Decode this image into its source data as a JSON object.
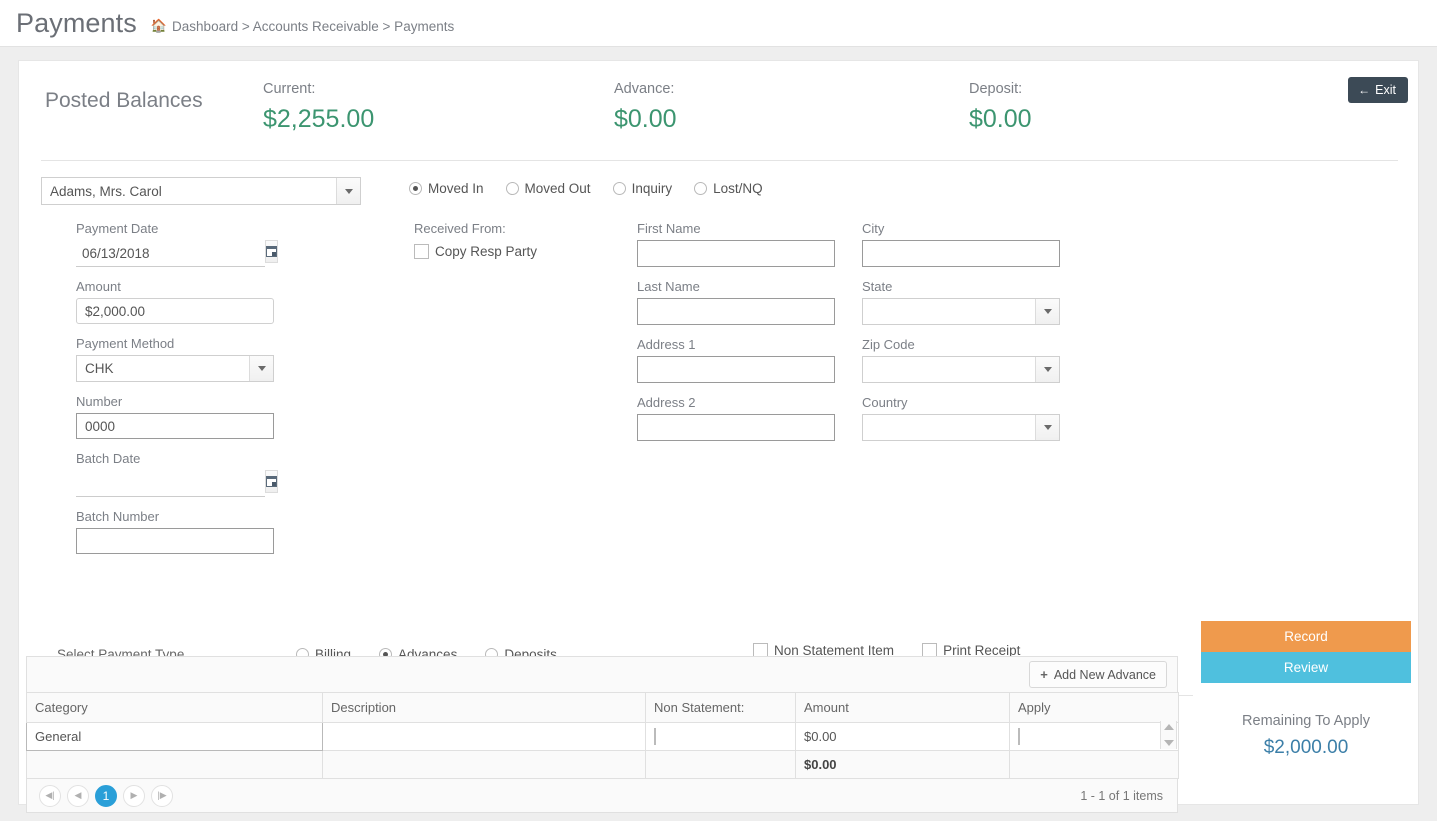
{
  "header": {
    "title": "Payments",
    "home_icon": "home-icon",
    "breadcrumb": "Dashboard > Accounts Receivable > Payments"
  },
  "balances": {
    "section_label": "Posted Balances",
    "items": [
      {
        "label": "Current:",
        "value": "$2,255.00"
      },
      {
        "label": "Advance:",
        "value": "$0.00"
      },
      {
        "label": "Deposit:",
        "value": "$0.00"
      }
    ],
    "value_color": "#3c9570"
  },
  "exit": {
    "label": "Exit",
    "icon": "arrow-left-icon",
    "color": "#3c4a56"
  },
  "selector": {
    "person": "Adams, Mrs. Carol",
    "dropdown_icon": "chevron-down-icon",
    "status_options": [
      {
        "label": "Moved In",
        "selected": true
      },
      {
        "label": "Moved Out",
        "selected": false
      },
      {
        "label": "Inquiry",
        "selected": false
      },
      {
        "label": "Lost/NQ",
        "selected": false
      }
    ]
  },
  "form": {
    "payment_date": {
      "label": "Payment Date",
      "value": "06/13/2018",
      "icon": "calendar-icon"
    },
    "amount": {
      "label": "Amount",
      "value": "$2,000.00"
    },
    "payment_method": {
      "label": "Payment Method",
      "value": "CHK",
      "icon": "chevron-down-icon"
    },
    "number": {
      "label": "Number",
      "value": "0000"
    },
    "batch_date": {
      "label": "Batch Date",
      "value": "",
      "icon": "calendar-icon"
    },
    "batch_number": {
      "label": "Batch Number",
      "value": ""
    },
    "received_from": {
      "label": "Received From:",
      "copy_resp_party": "Copy Resp Party",
      "copy_checked": false
    },
    "first_name": {
      "label": "First Name",
      "value": ""
    },
    "last_name": {
      "label": "Last Name",
      "value": ""
    },
    "address1": {
      "label": "Address 1",
      "value": ""
    },
    "address2": {
      "label": "Address 2",
      "value": ""
    },
    "city": {
      "label": "City",
      "value": ""
    },
    "state": {
      "label": "State",
      "value": ""
    },
    "zip_code": {
      "label": "Zip Code",
      "value": ""
    },
    "country": {
      "label": "Country",
      "value": ""
    }
  },
  "payment_type": {
    "label": "Select Payment Type",
    "options": [
      {
        "label": "Billing",
        "selected": false
      },
      {
        "label": "Advances",
        "selected": true
      },
      {
        "label": "Deposits",
        "selected": false
      }
    ],
    "checkboxes": [
      {
        "label": "Non Statement Item",
        "checked": false
      },
      {
        "label": "Print Receipt",
        "checked": false
      }
    ]
  },
  "grid": {
    "add_button": {
      "label": "Add New Advance",
      "icon": "plus-icon"
    },
    "columns": [
      "Category",
      "Description",
      "Non Statement:",
      "Amount",
      "Apply"
    ],
    "rows": [
      {
        "category": "General",
        "description": "",
        "non_statement": false,
        "amount": "$0.00",
        "apply": false
      }
    ],
    "total": {
      "amount": "$0.00"
    },
    "pager": {
      "first_icon": "page-first-icon",
      "prev_icon": "page-prev-icon",
      "pages": [
        "1"
      ],
      "active_page": "1",
      "next_icon": "page-next-icon",
      "last_icon": "page-last-icon",
      "info": "1 - 1 of 1 items"
    }
  },
  "actions": {
    "record_label": "Record",
    "review_label": "Review",
    "record_color": "#ef9a4d",
    "review_color": "#4fc0de",
    "remaining_label": "Remaining To Apply",
    "remaining_value": "$2,000.00"
  }
}
